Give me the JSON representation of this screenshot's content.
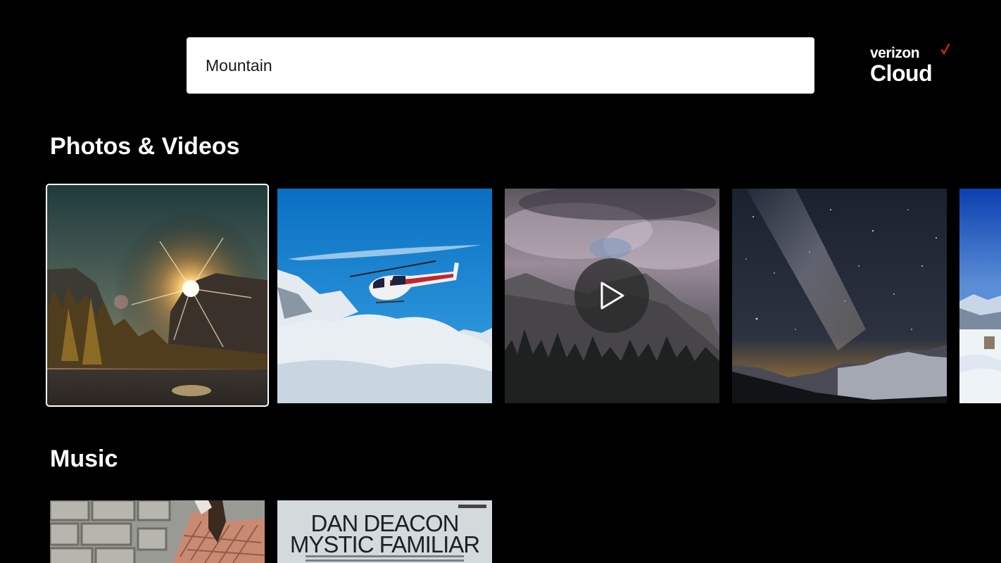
{
  "search": {
    "value": "Mountain"
  },
  "brand": {
    "line1": "verizon",
    "line2": "Cloud",
    "check_color": "#e3261b"
  },
  "sections": {
    "photos_videos": {
      "title": "Photos & Videos"
    },
    "music": {
      "title": "Music"
    }
  },
  "photos": [
    {
      "kind": "photo",
      "subject": "sunburst over valley cliffs",
      "selected": true
    },
    {
      "kind": "photo",
      "subject": "helicopter above snowy peaks"
    },
    {
      "kind": "video",
      "subject": "cloudy granite cliff",
      "overlay_icon": "play-icon"
    },
    {
      "kind": "photo",
      "subject": "milky way over mountains"
    },
    {
      "kind": "photo",
      "subject": "snowy ski slope (partially visible)"
    }
  ],
  "music": {
    "albums": [
      {
        "subject": "cover art with stone wall and fabric"
      },
      {
        "title_line1": "DAN DEACON",
        "title_line2": "MYSTIC FAMILIAR"
      }
    ]
  },
  "colors": {
    "background": "#000000",
    "search_bg": "#ffffff",
    "text": "#ffffff"
  }
}
